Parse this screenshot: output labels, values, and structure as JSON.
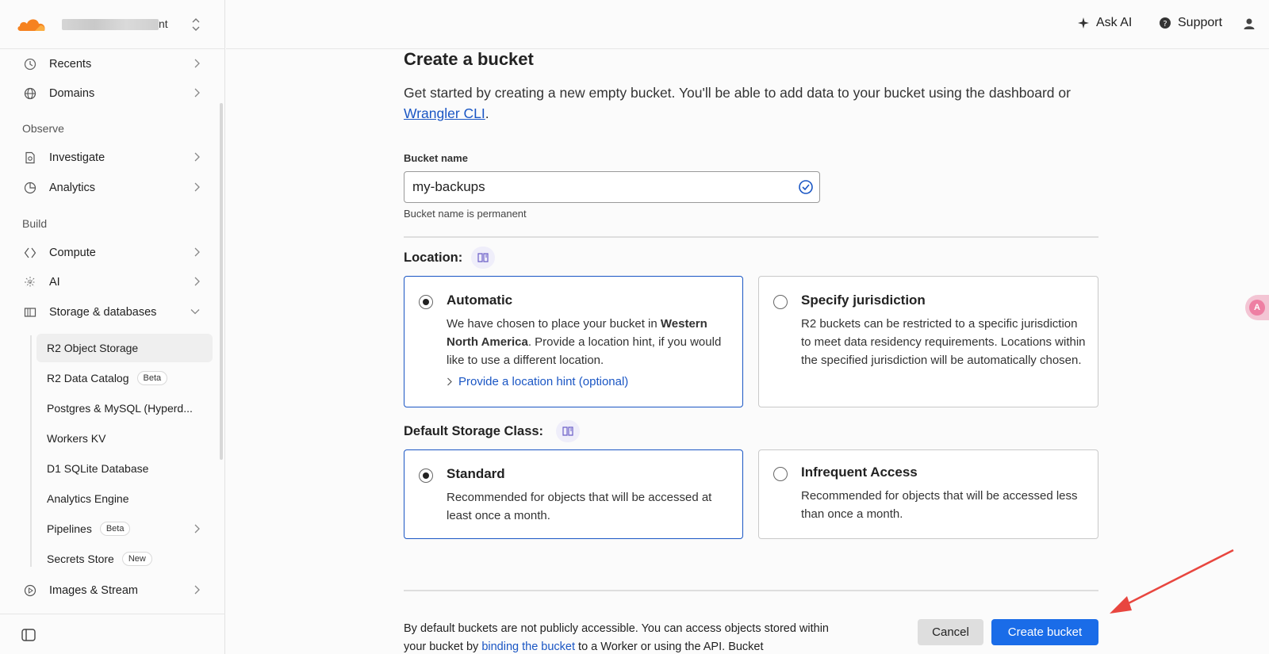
{
  "sidebar": {
    "account_suffix": "nt",
    "nav": {
      "recents": "Recents",
      "domains": "Domains",
      "observe": "Observe",
      "investigate": "Investigate",
      "analytics": "Analytics",
      "build": "Build",
      "compute": "Compute",
      "ai": "AI",
      "storage": "Storage & databases",
      "images": "Images & Stream"
    },
    "storage_items": {
      "r2": "R2 Object Storage",
      "r2_catalog": "R2 Data Catalog",
      "r2_catalog_badge": "Beta",
      "postgres": "Postgres & MySQL (Hyperd...",
      "workers_kv": "Workers KV",
      "d1": "D1 SQLite Database",
      "analytics_engine": "Analytics Engine",
      "pipelines": "Pipelines",
      "pipelines_badge": "Beta",
      "secrets": "Secrets Store",
      "secrets_badge": "New"
    }
  },
  "topbar": {
    "ask_ai": "Ask AI",
    "support": "Support"
  },
  "main": {
    "title": "Create a bucket",
    "intro_text": "Get started by creating a new empty bucket. You'll be able to add data to your bucket using the dashboard or ",
    "intro_link": "Wrangler CLI",
    "intro_end": ".",
    "bucket_label": "Bucket name",
    "bucket_value": "my-backups",
    "bucket_helper": "Bucket name is permanent",
    "location_label": "Location:",
    "auto": {
      "title": "Automatic",
      "desc_1": "We have chosen to place your bucket in ",
      "desc_bold": "Western North America",
      "desc_2": ". Provide a location hint, if you would like to use a different location.",
      "hint": "Provide a location hint (optional)"
    },
    "jurisdiction": {
      "title": "Specify jurisdiction",
      "desc": "R2 buckets can be restricted to a specific jurisdiction to meet data residency requirements. Locations within the specified jurisdiction will be automatically chosen."
    },
    "storage_class_label": "Default Storage Class:",
    "standard": {
      "title": "Standard",
      "desc": "Recommended for objects that will be accessed at least once a month."
    },
    "infrequent": {
      "title": "Infrequent Access",
      "desc": "Recommended for objects that will be accessed less than once a month."
    },
    "footnote_1": "By default buckets are not publicly accessible. You can access objects stored within your bucket by ",
    "footnote_link": "binding the bucket",
    "footnote_2": " to a Worker or using the API. Bucket",
    "cancel": "Cancel",
    "create": "Create bucket"
  },
  "colors": {
    "accent": "#1a56c4",
    "primary_button": "#1a6ce8",
    "logo": "#f6821f"
  }
}
